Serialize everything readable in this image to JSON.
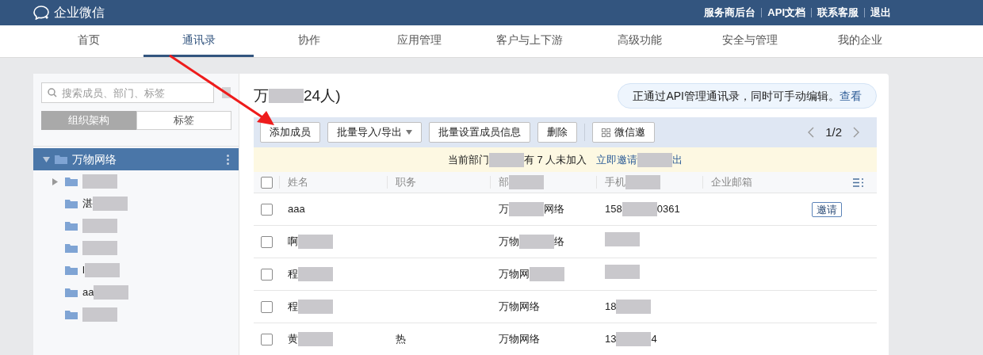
{
  "header": {
    "brand": "企业微信",
    "links": [
      "服务商后台",
      "API文档",
      "联系客服",
      "退出"
    ]
  },
  "nav": [
    {
      "label": "首页",
      "selected": false
    },
    {
      "label": "通讯录",
      "selected": true
    },
    {
      "label": "协作",
      "selected": false
    },
    {
      "label": "应用管理",
      "selected": false
    },
    {
      "label": "客户与上下游",
      "selected": false
    },
    {
      "label": "高级功能",
      "selected": false
    },
    {
      "label": "安全与管理",
      "selected": false
    },
    {
      "label": "我的企业",
      "selected": false
    }
  ],
  "sidebar": {
    "search": {
      "placeholder": "搜索成员、部门、标签"
    },
    "tabs": [
      {
        "label": "组织架构",
        "selected": true
      },
      {
        "label": "标签",
        "selected": false
      }
    ],
    "tree": {
      "label": "万物网络",
      "expanded": true,
      "selected": true,
      "children": [
        {
          "segments": [
            {
              "kind": "blur"
            }
          ],
          "has_children": true
        },
        {
          "segments": [
            {
              "kind": "text",
              "text": "湛"
            },
            {
              "kind": "blur"
            }
          ],
          "has_children": false
        },
        {
          "segments": [
            {
              "kind": "blur"
            }
          ],
          "has_children": false
        },
        {
          "segments": [
            {
              "kind": "blur"
            }
          ],
          "has_children": false
        },
        {
          "segments": [
            {
              "kind": "text",
              "text": "l"
            },
            {
              "kind": "blur"
            }
          ],
          "has_children": false
        },
        {
          "segments": [
            {
              "kind": "text",
              "text": "aa"
            },
            {
              "kind": "blur"
            }
          ],
          "has_children": false
        },
        {
          "segments": [
            {
              "kind": "blur"
            }
          ],
          "has_children": false
        }
      ]
    }
  },
  "main": {
    "title": [
      {
        "kind": "text",
        "text": "万"
      },
      {
        "kind": "blur"
      },
      {
        "kind": "text",
        "text": "24人)"
      }
    ],
    "api_notice": {
      "text": "正通过API管理通讯录，同时可手动编辑。",
      "link": "查看"
    },
    "toolbar": [
      {
        "kind": "button",
        "label": "添加成员"
      },
      {
        "kind": "dropdown",
        "label": "批量导入/导出"
      },
      {
        "kind": "button",
        "label": "批量设置成员信息"
      },
      {
        "kind": "button",
        "label": "删除"
      },
      {
        "kind": "qr",
        "label": "微信邀"
      }
    ],
    "pager": "1/2",
    "notice": {
      "text": [
        {
          "kind": "text",
          "text": "当前部门"
        },
        {
          "kind": "blur"
        },
        {
          "kind": "text",
          "text": "有 7 人未加入"
        }
      ],
      "link": [
        {
          "kind": "text",
          "text": "立即邀请"
        },
        {
          "kind": "blur"
        },
        {
          "kind": "text",
          "text": "出"
        }
      ]
    },
    "table": {
      "header_checked": false,
      "columns": [
        [
          {
            "kind": "text",
            "text": "姓名"
          }
        ],
        [
          {
            "kind": "text",
            "text": "职务"
          }
        ],
        [
          {
            "kind": "text",
            "text": "部"
          },
          {
            "kind": "blur"
          }
        ],
        [
          {
            "kind": "text",
            "text": "手机"
          },
          {
            "kind": "blur"
          }
        ],
        [
          {
            "kind": "text",
            "text": "企业邮箱"
          }
        ]
      ],
      "rows": [
        {
          "checked": false,
          "name": [
            {
              "kind": "text",
              "text": "aaa"
            }
          ],
          "dept": [
            {
              "kind": "text",
              "text": "万"
            },
            {
              "kind": "blur"
            },
            {
              "kind": "text",
              "text": "网络"
            }
          ],
          "phone": [
            {
              "kind": "text",
              "text": "158"
            },
            {
              "kind": "blur"
            },
            {
              "kind": "text",
              "text": "0361"
            }
          ],
          "action": "邀请"
        },
        {
          "checked": false,
          "name": [
            {
              "kind": "text",
              "text": "啊"
            },
            {
              "kind": "blur"
            }
          ],
          "dept": [
            {
              "kind": "text",
              "text": "万物"
            },
            {
              "kind": "blur"
            },
            {
              "kind": "text",
              "text": "络"
            }
          ],
          "phone": [
            {
              "kind": "blur"
            }
          ]
        },
        {
          "checked": false,
          "name": [
            {
              "kind": "text",
              "text": "程"
            },
            {
              "kind": "blur"
            }
          ],
          "dept": [
            {
              "kind": "text",
              "text": "万物网"
            },
            {
              "kind": "blur"
            }
          ],
          "phone": [
            {
              "kind": "blur"
            }
          ]
        },
        {
          "checked": false,
          "name": [
            {
              "kind": "text",
              "text": "程"
            },
            {
              "kind": "blur"
            }
          ],
          "dept": [
            {
              "kind": "text",
              "text": "万物网络"
            }
          ],
          "phone": [
            {
              "kind": "text",
              "text": "18"
            },
            {
              "kind": "blur"
            }
          ]
        },
        {
          "checked": false,
          "name": [
            {
              "kind": "text",
              "text": "黄"
            },
            {
              "kind": "blur"
            }
          ],
          "role": [
            {
              "kind": "text",
              "text": "热"
            }
          ],
          "dept": [
            {
              "kind": "text",
              "text": "万物网络"
            }
          ],
          "phone": [
            {
              "kind": "text",
              "text": "13"
            },
            {
              "kind": "blur"
            },
            {
              "kind": "text",
              "text": "4"
            }
          ]
        }
      ]
    }
  }
}
